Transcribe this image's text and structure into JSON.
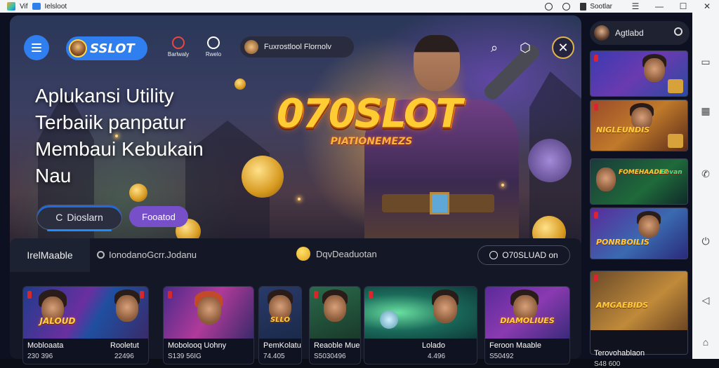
{
  "titlebar": {
    "app_name": "Vif",
    "tab_title": "Ielsloot",
    "right_label": "Sootlar"
  },
  "header": {
    "brand": "SSLOT",
    "tools": [
      {
        "label": "Barlwaly"
      },
      {
        "label": "Rwelo"
      }
    ],
    "search_chip": "Fuxrostlool Flornolv"
  },
  "hero": {
    "headline": [
      "Aplukansi Utility",
      "Terbaiik panpatur",
      "Membaui Kebukain",
      "Nau"
    ],
    "logo": "070SLOT",
    "logo_sub": "PIATIONEMEZS",
    "primary_button": "Dioslarn",
    "primary_icon": "C",
    "secondary_button": "Fooatod"
  },
  "shelf": {
    "tab": "IrelMaable",
    "search": "IonodanoGcrr.Jodanu",
    "coin_label": "DqvDeaduotan",
    "pill": "O70SLUAD on",
    "games": [
      {
        "art_title": "JALOUD",
        "name": "Mobloaata",
        "price": "230 396"
      },
      {
        "art_title": "",
        "name": "Rooletut",
        "price": "22496"
      },
      {
        "art_title": "",
        "name": "Mobolooq Uohny",
        "price": "S139 56IG"
      },
      {
        "art_title": "SLLO",
        "name": "PemKolatu",
        "price": "74.405"
      },
      {
        "art_title": "",
        "name": "Reaoble Mue",
        "price": "S5030496"
      },
      {
        "art_title": "",
        "name": "Lolado",
        "price": "4.496"
      },
      {
        "art_title": "DIAMOLIUES",
        "name": "Feroon Maable",
        "price": "S50492"
      }
    ]
  },
  "sidebar": {
    "search_label": "Agtlabd",
    "cards": [
      {
        "title": ""
      },
      {
        "title": "NIGLEUNDIS"
      },
      {
        "title": "FOMEHAADEC",
        "extra": "Eevan"
      },
      {
        "title": "PONRBOILIS"
      },
      {
        "title": "AMGAEBIDS"
      }
    ],
    "bottom_name": "Terovohablaon",
    "bottom_price": "S48 600"
  },
  "colors": {
    "brand_blue": "#2f7ff0",
    "accent_purple": "#7750c9",
    "gold": "#ffcc33",
    "bg": "#0c1020"
  }
}
